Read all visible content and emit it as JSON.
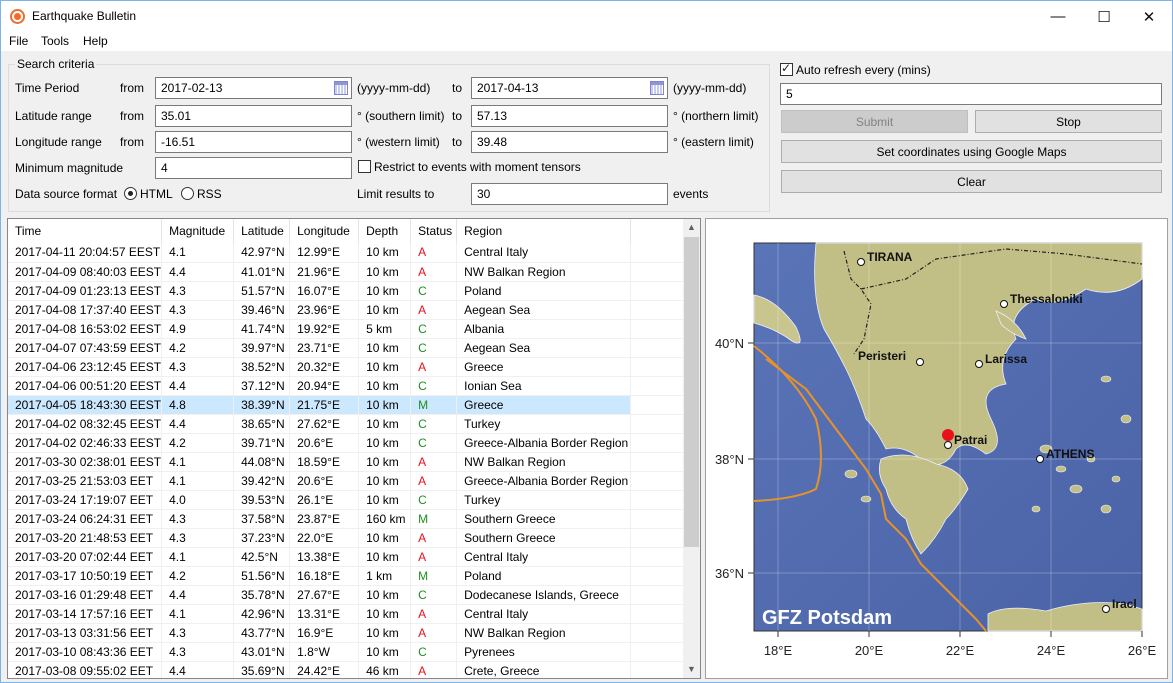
{
  "window": {
    "title": "Earthquake Bulletin",
    "controls": {
      "minimize": "—",
      "maximize": "☐",
      "close": "✕"
    }
  },
  "menu": [
    "File",
    "Tools",
    "Help"
  ],
  "search": {
    "legend": "Search criteria",
    "time_period": {
      "label": "Time Period",
      "from_label": "from",
      "from": "2017-02-13",
      "from_hint": "(yyyy-mm-dd)",
      "to_label": "to",
      "to": "2017-04-13",
      "to_hint": "(yyyy-mm-dd)"
    },
    "latitude": {
      "label": "Latitude range",
      "from_label": "from",
      "from": "35.01",
      "from_hint": "° (southern limit)",
      "to_label": "to",
      "to": "57.13",
      "to_hint": "° (northern limit)"
    },
    "longitude": {
      "label": "Longitude range",
      "from_label": "from",
      "from": "-16.51",
      "from_hint": "° (western limit)",
      "to_label": "to",
      "to": "39.48",
      "to_hint": "° (eastern limit)"
    },
    "min_magnitude": {
      "label": "Minimum magnitude",
      "value": "4"
    },
    "moment_tensors": {
      "label": "Restrict to events with moment tensors",
      "checked": false
    },
    "data_source": {
      "label": "Data source format",
      "options": [
        "HTML",
        "RSS"
      ],
      "selected": "HTML"
    },
    "limit": {
      "label": "Limit results to",
      "value": "30",
      "suffix": "events"
    }
  },
  "refresh": {
    "label": "Auto refresh every (mins)",
    "checked": true,
    "value": "5",
    "submit": "Submit",
    "stop": "Stop",
    "google_maps": "Set coordinates using Google Maps",
    "clear": "Clear"
  },
  "table": {
    "columns": [
      "Time",
      "Magnitude",
      "Latitude",
      "Longitude",
      "Depth",
      "Status",
      "Region"
    ],
    "selected_index": 8,
    "rows": [
      [
        "2017-04-11 20:04:57 EEST",
        "4.1",
        "42.97°N",
        "12.99°E",
        "10 km",
        "A",
        "Central Italy"
      ],
      [
        "2017-04-09 08:40:03 EEST",
        "4.4",
        "41.01°N",
        "21.96°E",
        "10 km",
        "A",
        "NW Balkan Region"
      ],
      [
        "2017-04-09 01:23:13 EEST",
        "4.3",
        "51.57°N",
        "16.07°E",
        "10 km",
        "C",
        "Poland"
      ],
      [
        "2017-04-08 17:37:40 EEST",
        "4.3",
        "39.46°N",
        "23.96°E",
        "10 km",
        "A",
        "Aegean Sea"
      ],
      [
        "2017-04-08 16:53:02 EEST",
        "4.9",
        "41.74°N",
        "19.92°E",
        "5 km",
        "C",
        "Albania"
      ],
      [
        "2017-04-07 07:43:59 EEST",
        "4.2",
        "39.97°N",
        "23.71°E",
        "10 km",
        "C",
        "Aegean Sea"
      ],
      [
        "2017-04-06 23:12:45 EEST",
        "4.3",
        "38.52°N",
        "20.32°E",
        "10 km",
        "A",
        "Greece"
      ],
      [
        "2017-04-06 00:51:20 EEST",
        "4.4",
        "37.12°N",
        "20.94°E",
        "10 km",
        "C",
        "Ionian Sea"
      ],
      [
        "2017-04-05 18:43:30 EEST",
        "4.8",
        "38.39°N",
        "21.75°E",
        "10 km",
        "M",
        "Greece"
      ],
      [
        "2017-04-02 08:32:45 EEST",
        "4.4",
        "38.65°N",
        "27.62°E",
        "10 km",
        "C",
        "Turkey"
      ],
      [
        "2017-04-02 02:46:33 EEST",
        "4.2",
        "39.71°N",
        "20.6°E",
        "10 km",
        "C",
        "Greece-Albania Border Region"
      ],
      [
        "2017-03-30 02:38:01 EEST",
        "4.1",
        "44.08°N",
        "18.59°E",
        "10 km",
        "A",
        "NW Balkan Region"
      ],
      [
        "2017-03-25 21:53:03 EET",
        "4.1",
        "39.42°N",
        "20.6°E",
        "10 km",
        "A",
        "Greece-Albania Border Region"
      ],
      [
        "2017-03-24 17:19:07 EET",
        "4.0",
        "39.53°N",
        "26.1°E",
        "10 km",
        "C",
        "Turkey"
      ],
      [
        "2017-03-24 06:24:31 EET",
        "4.3",
        "37.58°N",
        "23.87°E",
        "160 km",
        "M",
        "Southern Greece"
      ],
      [
        "2017-03-20 21:48:53 EET",
        "4.3",
        "37.23°N",
        "22.0°E",
        "10 km",
        "A",
        "Southern Greece"
      ],
      [
        "2017-03-20 07:02:44 EET",
        "4.1",
        "42.5°N",
        "13.38°E",
        "10 km",
        "A",
        "Central Italy"
      ],
      [
        "2017-03-17 10:50:19 EET",
        "4.2",
        "51.56°N",
        "16.18°E",
        "1 km",
        "M",
        "Poland"
      ],
      [
        "2017-03-16 01:29:48 EET",
        "4.4",
        "35.78°N",
        "27.67°E",
        "10 km",
        "C",
        "Dodecanese Islands, Greece"
      ],
      [
        "2017-03-14 17:57:16 EET",
        "4.1",
        "42.96°N",
        "13.31°E",
        "10 km",
        "A",
        "Central Italy"
      ],
      [
        "2017-03-13 03:31:56 EET",
        "4.3",
        "43.77°N",
        "16.9°E",
        "10 km",
        "A",
        "NW Balkan Region"
      ],
      [
        "2017-03-10 08:43:36 EET",
        "4.3",
        "43.01°N",
        "1.8°W",
        "10 km",
        "C",
        "Pyrenees"
      ],
      [
        "2017-03-08 09:55:02 EET",
        "4.4",
        "35.69°N",
        "24.42°E",
        "46 km",
        "A",
        "Crete, Greece"
      ]
    ],
    "scroll": {
      "up": "▲",
      "down": "▼"
    }
  },
  "map": {
    "credit": "GFZ Potsdam",
    "lat_ticks": [
      "40°N",
      "38°N",
      "36°N"
    ],
    "lon_ticks": [
      "18°E",
      "20°E",
      "22°E",
      "24°E",
      "26°E"
    ],
    "cities": [
      {
        "name": "TIRANA"
      },
      {
        "name": "Thessaloniki"
      },
      {
        "name": "Peristeri"
      },
      {
        "name": "Larissa"
      },
      {
        "name": "Patrai"
      },
      {
        "name": "ATHENS"
      },
      {
        "name": "Iracl"
      }
    ],
    "epicenter_color": "#e8111b",
    "plate_boundary_color": "#e8922a"
  }
}
